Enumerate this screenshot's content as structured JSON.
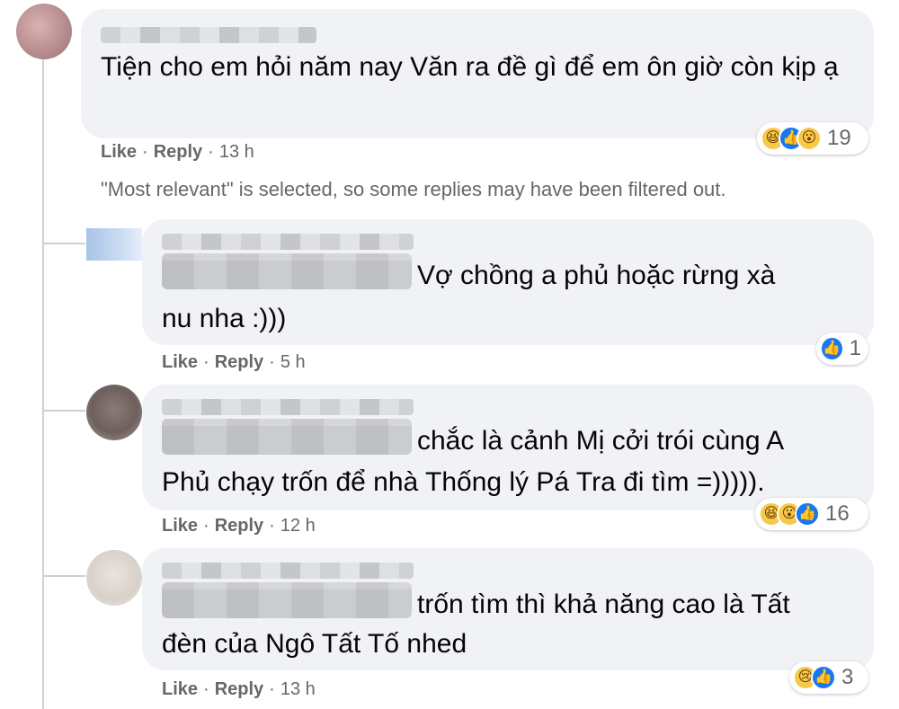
{
  "main_comment": {
    "text": "Tiện cho em hỏi năm nay Văn ra đề gì để em ôn giờ còn kịp ạ",
    "actions": {
      "like": "Like",
      "reply": "Reply",
      "time": "13 h"
    },
    "reactions": {
      "icons": [
        "haha-icon",
        "like-icon",
        "wow-icon"
      ],
      "count": "19"
    }
  },
  "filter_notice": "\"Most relevant\" is selected, so some replies may have been filtered out.",
  "replies": [
    {
      "line1": "Vợ chồng a phủ hoặc rừng xà",
      "line2": "nu nha :)))",
      "actions": {
        "like": "Like",
        "reply": "Reply",
        "time": "5 h"
      },
      "reactions": {
        "icons": [
          "like-icon"
        ],
        "count": "1"
      }
    },
    {
      "line1": "chắc là cảnh Mị cởi trói cùng A",
      "line2": "Phủ chạy trốn để nhà Thống lý Pá Tra đi tìm =))))).",
      "actions": {
        "like": "Like",
        "reply": "Reply",
        "time": "12 h"
      },
      "reactions": {
        "icons": [
          "haha-icon",
          "wow-icon",
          "like-icon"
        ],
        "count": "16"
      }
    },
    {
      "line1": "trốn tìm thì khả năng cao là Tất",
      "line2": "đèn của Ngô Tất Tố nhed",
      "actions": {
        "like": "Like",
        "reply": "Reply",
        "time": "13 h"
      },
      "reactions": {
        "icons": [
          "sad-icon",
          "like-icon"
        ],
        "count": "3"
      }
    }
  ],
  "separator": "·",
  "colors": {
    "bubble": "#f0f2f5",
    "meta": "#65676b",
    "like_blue": "#1877f2",
    "thread_line": "#ced0d4"
  }
}
